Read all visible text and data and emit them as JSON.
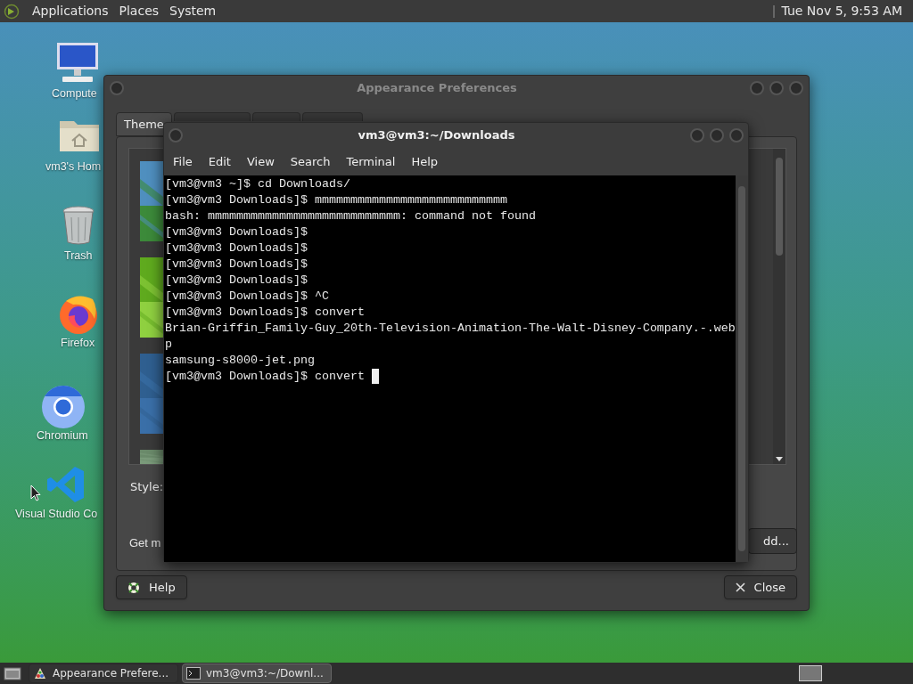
{
  "top_panel": {
    "menus": [
      "Applications",
      "Places",
      "System"
    ],
    "clock": "Tue Nov 5, 9:53 AM"
  },
  "desktop_icons": [
    {
      "label": "Compute",
      "kind": "computer"
    },
    {
      "label": "vm3's Hom",
      "kind": "home"
    },
    {
      "label": "Trash",
      "kind": "trash"
    },
    {
      "label": "Firefox",
      "kind": "firefox"
    },
    {
      "label": "Chromium",
      "kind": "chromium"
    },
    {
      "label": "Visual Studio Co",
      "kind": "vscode"
    }
  ],
  "appearance_window": {
    "title": "Appearance Preferences",
    "tabs": [
      {
        "label": "Theme",
        "selected": true
      }
    ],
    "style_label": "Style:",
    "get_more_label": "Get m",
    "add_button": "dd...",
    "help_button": "Help",
    "close_button": "Close"
  },
  "terminal": {
    "title": "vm3@vm3:~/Downloads",
    "menus": [
      "File",
      "Edit",
      "View",
      "Search",
      "Terminal",
      "Help"
    ],
    "lines": [
      "[vm3@vm3 ~]$ cd Downloads/",
      "[vm3@vm3 Downloads]$ mmmmmmmmmmmmmmmmmmmmmmmmmmm",
      "bash: mmmmmmmmmmmmmmmmmmmmmmmmmmm: command not found",
      "[vm3@vm3 Downloads]$",
      "[vm3@vm3 Downloads]$",
      "[vm3@vm3 Downloads]$",
      "[vm3@vm3 Downloads]$",
      "[vm3@vm3 Downloads]$ ^C",
      "[vm3@vm3 Downloads]$ convert",
      "Brian-Griffin_Family-Guy_20th-Television-Animation-The-Walt-Disney-Company.-.web",
      "p",
      "samsung-s8000-jet.png",
      "[vm3@vm3 Downloads]$ convert "
    ]
  },
  "taskbar": {
    "tasks": [
      {
        "label": "Appearance Prefere...",
        "kind": "appearance",
        "selected": false
      },
      {
        "label": "vm3@vm3:~/Downl...",
        "kind": "terminal",
        "selected": true
      }
    ]
  }
}
